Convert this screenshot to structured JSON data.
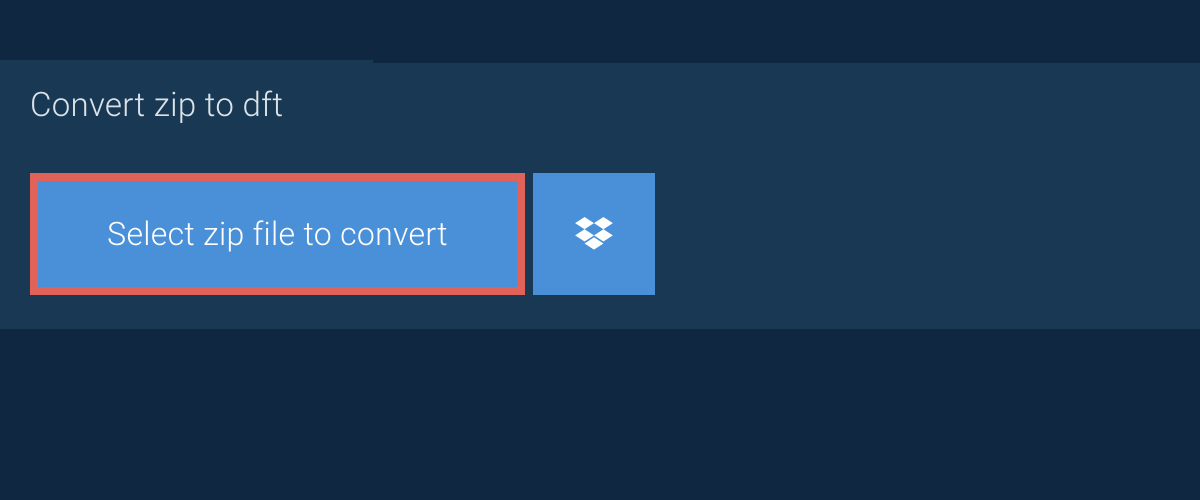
{
  "tab": {
    "label": "Convert zip to dft"
  },
  "actions": {
    "select_label": "Select zip file to convert"
  }
}
